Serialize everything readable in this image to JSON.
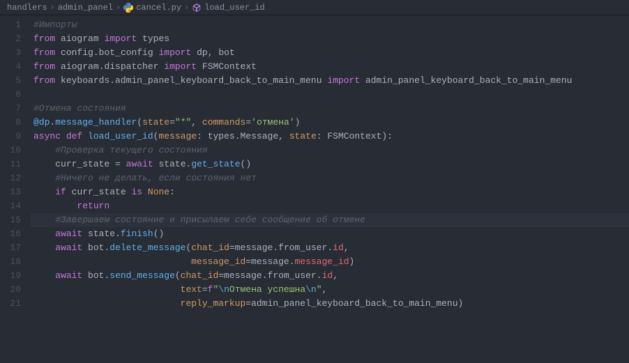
{
  "breadcrumbs": {
    "folder": "handlers",
    "folder2": "admin_panel",
    "file": "cancel.py",
    "symbol": "load_user_id"
  },
  "lines": {
    "l1_comment": "#Импорты",
    "l2_from": "from",
    "l2_mod": "aiogram",
    "l2_import": "import",
    "l2_name": "types",
    "l3_from": "from",
    "l3_mod": "config.bot_config",
    "l3_import": "import",
    "l3_name1": "dp",
    "l3_name2": "bot",
    "l4_from": "from",
    "l4_mod": "aiogram.dispatcher",
    "l4_import": "import",
    "l4_name": "FSMContext",
    "l5_from": "from",
    "l5_mod": "keyboards.admin_panel_keyboard_back_to_main_menu",
    "l5_import": "import",
    "l5_name": "admin_panel_keyboard_back_to_main_menu",
    "l7_comment": "#Отмена состояния",
    "l8_dec": "@dp",
    "l8_method": "message_handler",
    "l8_arg1k": "state",
    "l8_arg1v": "\"*\"",
    "l8_arg2k": "commands",
    "l8_arg2v": "'отмена'",
    "l9_async": "async",
    "l9_def": "def",
    "l9_func": "load_user_id",
    "l9_p1": "message",
    "l9_t1": "types.Message",
    "l9_p2": "state",
    "l9_t2": "FSMContext",
    "l10_comment": "#Проверка текущего состояния",
    "l11_var": "curr_state",
    "l11_await": "await",
    "l11_obj": "state",
    "l11_method": "get_state",
    "l12_comment": "#Ничего не делать, если состояния нет",
    "l13_if": "if",
    "l13_var": "curr_state",
    "l13_is": "is",
    "l13_none": "None",
    "l14_return": "return",
    "l15_comment": "#Завершаем состояние и присылаем себе сообщение об отмене",
    "l16_await": "await",
    "l16_obj": "state",
    "l16_method": "finish",
    "l17_await": "await",
    "l17_obj": "bot",
    "l17_method": "delete_message",
    "l17_k1": "chat_id",
    "l17_v1a": "message",
    "l17_v1b": "from_user",
    "l17_v1c": "id",
    "l18_k": "message_id",
    "l18_va": "message",
    "l18_vb": "message_id",
    "l19_await": "await",
    "l19_obj": "bot",
    "l19_method": "send_message",
    "l19_k1": "chat_id",
    "l19_v1a": "message",
    "l19_v1b": "from_user",
    "l19_v1c": "id",
    "l20_k": "text",
    "l20_f": "f",
    "l20_q1": "\"",
    "l20_esc1": "\\n",
    "l20_txt": "Отмена успешна",
    "l20_esc2": "\\n",
    "l20_q2": "\"",
    "l21_k": "reply_markup",
    "l21_v": "admin_panel_keyboard_back_to_main_menu"
  },
  "gutter": [
    "1",
    "2",
    "3",
    "4",
    "5",
    "6",
    "7",
    "8",
    "9",
    "10",
    "11",
    "12",
    "13",
    "14",
    "15",
    "16",
    "17",
    "18",
    "19",
    "20",
    "21"
  ]
}
